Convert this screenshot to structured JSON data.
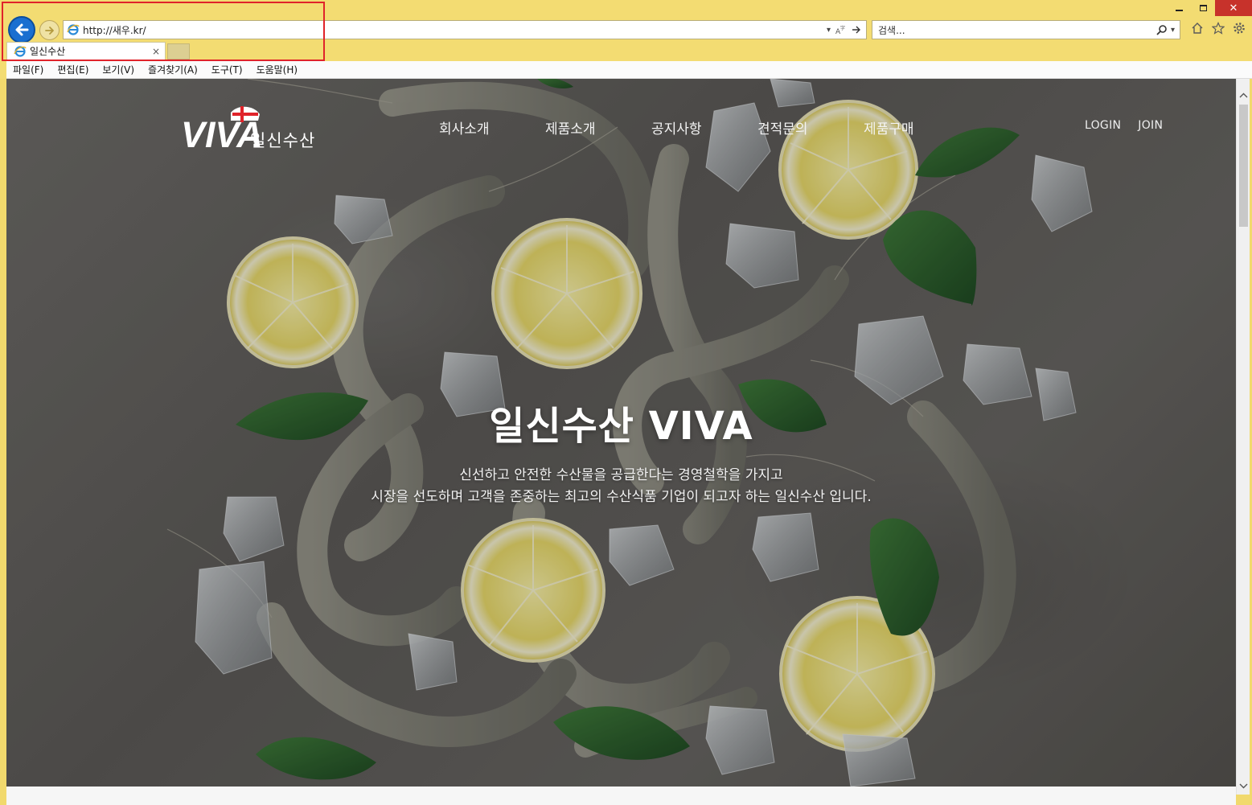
{
  "browser": {
    "address": "http://새우.kr/",
    "search_placeholder": "검색...",
    "tab_title": "일신수산",
    "tab_close": "×",
    "menu": [
      "파일(F)",
      "편집(E)",
      "보기(V)",
      "즐겨찾기(A)",
      "도구(T)",
      "도움말(H)"
    ],
    "accent_color": "#1a6fd0",
    "highlight_color": "#e0232a"
  },
  "site": {
    "logo_mark": "VIVA",
    "logo_text": "일신수산",
    "nav": [
      "회사소개",
      "제품소개",
      "공지사항",
      "견적문의",
      "제품구매"
    ],
    "login": "LOGIN",
    "join": "JOIN",
    "hero_title": "일신수산 VIVA",
    "hero_line1": "신선하고 안전한 수산물을 공급한다는 경영철학을 가지고",
    "hero_line2": "시장을 선도하며 고객을 존중하는 최고의 수산식품 기업이 되고자 하는 일신수산 입니다."
  }
}
